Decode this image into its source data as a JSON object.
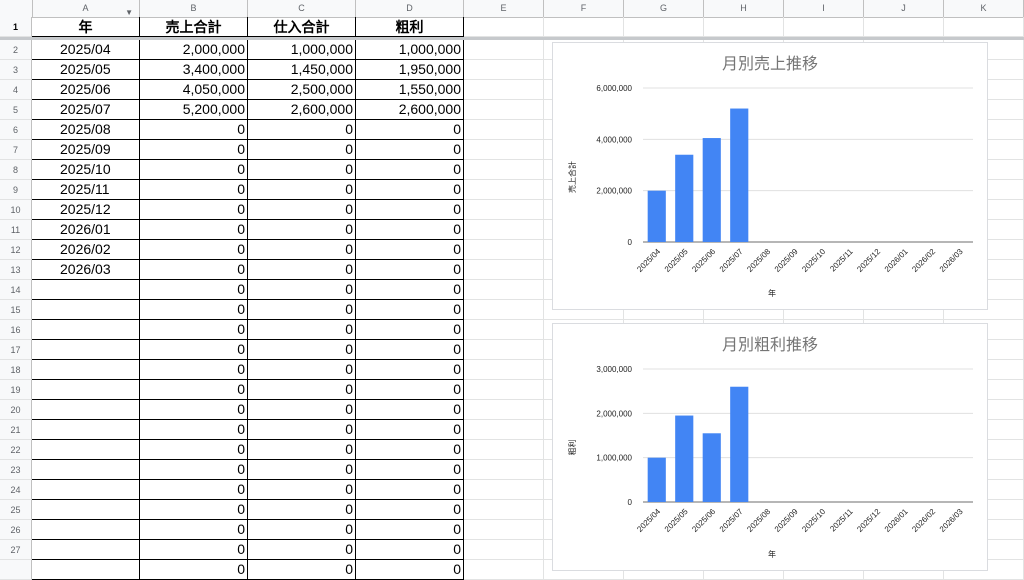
{
  "columns": [
    "A",
    "B",
    "C",
    "D",
    "E",
    "F",
    "G",
    "H",
    "I",
    "J",
    "K"
  ],
  "header_row_label": "1",
  "headers": {
    "a": "年",
    "b": "売上合計",
    "c": "仕入合計",
    "d": "粗利"
  },
  "rows": [
    {
      "n": "2",
      "a": "2025/04",
      "b": "2,000,000",
      "c": "1,000,000",
      "d": "1,000,000"
    },
    {
      "n": "3",
      "a": "2025/05",
      "b": "3,400,000",
      "c": "1,450,000",
      "d": "1,950,000"
    },
    {
      "n": "4",
      "a": "2025/06",
      "b": "4,050,000",
      "c": "2,500,000",
      "d": "1,550,000"
    },
    {
      "n": "5",
      "a": "2025/07",
      "b": "5,200,000",
      "c": "2,600,000",
      "d": "2,600,000"
    },
    {
      "n": "6",
      "a": "2025/08",
      "b": "0",
      "c": "0",
      "d": "0"
    },
    {
      "n": "7",
      "a": "2025/09",
      "b": "0",
      "c": "0",
      "d": "0"
    },
    {
      "n": "8",
      "a": "2025/10",
      "b": "0",
      "c": "0",
      "d": "0"
    },
    {
      "n": "9",
      "a": "2025/11",
      "b": "0",
      "c": "0",
      "d": "0"
    },
    {
      "n": "10",
      "a": "2025/12",
      "b": "0",
      "c": "0",
      "d": "0"
    },
    {
      "n": "11",
      "a": "2026/01",
      "b": "0",
      "c": "0",
      "d": "0"
    },
    {
      "n": "12",
      "a": "2026/02",
      "b": "0",
      "c": "0",
      "d": "0"
    },
    {
      "n": "13",
      "a": "2026/03",
      "b": "0",
      "c": "0",
      "d": "0"
    },
    {
      "n": "14",
      "a": "",
      "b": "0",
      "c": "0",
      "d": "0"
    },
    {
      "n": "15",
      "a": "",
      "b": "0",
      "c": "0",
      "d": "0"
    },
    {
      "n": "16",
      "a": "",
      "b": "0",
      "c": "0",
      "d": "0"
    },
    {
      "n": "17",
      "a": "",
      "b": "0",
      "c": "0",
      "d": "0"
    },
    {
      "n": "18",
      "a": "",
      "b": "0",
      "c": "0",
      "d": "0"
    },
    {
      "n": "19",
      "a": "",
      "b": "0",
      "c": "0",
      "d": "0"
    },
    {
      "n": "20",
      "a": "",
      "b": "0",
      "c": "0",
      "d": "0"
    },
    {
      "n": "21",
      "a": "",
      "b": "0",
      "c": "0",
      "d": "0"
    },
    {
      "n": "22",
      "a": "",
      "b": "0",
      "c": "0",
      "d": "0"
    },
    {
      "n": "23",
      "a": "",
      "b": "0",
      "c": "0",
      "d": "0"
    },
    {
      "n": "24",
      "a": "",
      "b": "0",
      "c": "0",
      "d": "0"
    },
    {
      "n": "25",
      "a": "",
      "b": "0",
      "c": "0",
      "d": "0"
    },
    {
      "n": "26",
      "a": "",
      "b": "0",
      "c": "0",
      "d": "0"
    },
    {
      "n": "27",
      "a": "",
      "b": "0",
      "c": "0",
      "d": "0"
    },
    {
      "n": "",
      "a": "",
      "b": "0",
      "c": "0",
      "d": "0"
    }
  ],
  "colors": {
    "bar": "#4285f4",
    "grid": "#e0e0e0",
    "title": "#757575"
  },
  "chart_data": [
    {
      "type": "bar",
      "title": "月別売上推移",
      "xlabel": "年",
      "ylabel": "売上合計",
      "categories": [
        "2025/04",
        "2025/05",
        "2025/06",
        "2025/07",
        "2025/08",
        "2025/09",
        "2025/10",
        "2025/11",
        "2025/12",
        "2026/01",
        "2026/02",
        "2026/03"
      ],
      "values": [
        2000000,
        3400000,
        4050000,
        5200000,
        0,
        0,
        0,
        0,
        0,
        0,
        0,
        0
      ],
      "ylim": [
        0,
        6000000
      ],
      "yticks": [
        "0",
        "2,000,000",
        "4,000,000",
        "6,000,000"
      ],
      "grid": true
    },
    {
      "type": "bar",
      "title": "月別粗利推移",
      "xlabel": "年",
      "ylabel": "粗利",
      "categories": [
        "2025/04",
        "2025/05",
        "2025/06",
        "2025/07",
        "2025/08",
        "2025/09",
        "2025/10",
        "2025/11",
        "2025/12",
        "2026/01",
        "2026/02",
        "2026/03"
      ],
      "values": [
        1000000,
        1950000,
        1550000,
        2600000,
        0,
        0,
        0,
        0,
        0,
        0,
        0,
        0
      ],
      "ylim": [
        0,
        3000000
      ],
      "yticks": [
        "0",
        "1,000,000",
        "2,000,000",
        "3,000,000"
      ],
      "grid": true
    }
  ]
}
